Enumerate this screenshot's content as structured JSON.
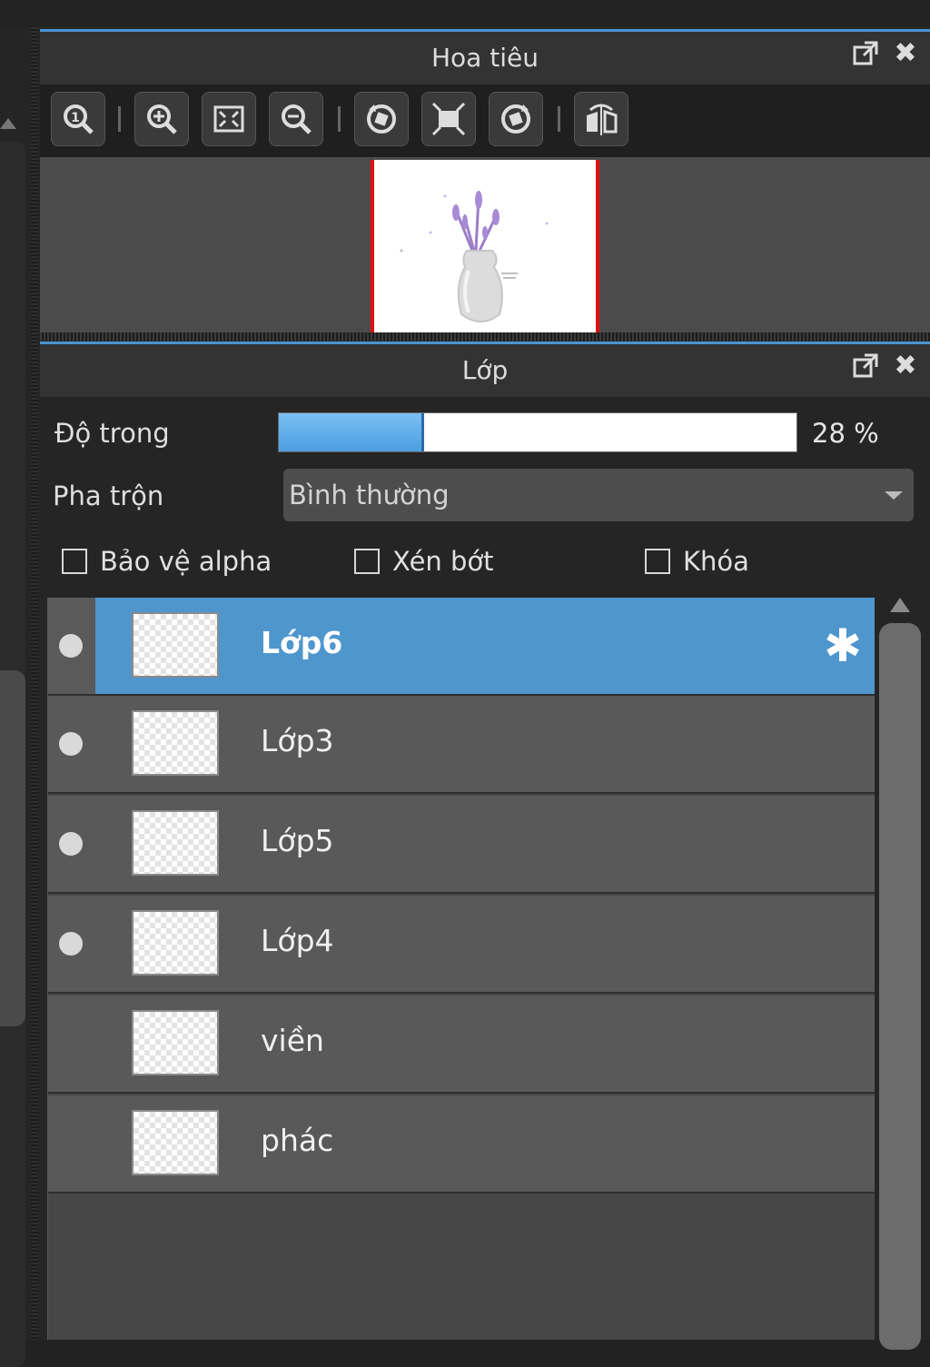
{
  "navigator": {
    "title": "Hoa tiêu",
    "toolbar": [
      {
        "icon": "zoom-actual-size-icon"
      },
      {
        "icon": "zoom-in-icon"
      },
      {
        "icon": "fit-to-window-icon"
      },
      {
        "icon": "zoom-out-icon"
      },
      {
        "icon": "rotate-left-icon"
      },
      {
        "icon": "fit-screen-icon"
      },
      {
        "icon": "rotate-right-icon"
      },
      {
        "icon": "flip-horizontal-icon"
      }
    ],
    "preview_image": "vase-with-lavender-preview"
  },
  "layers": {
    "title": "Lớp",
    "opacity_label": "Độ trong",
    "opacity_percent": 28,
    "opacity_value_text": "28 %",
    "blend_label": "Pha trộn",
    "blend_value": "Bình thường",
    "checkboxes": {
      "protect_alpha": {
        "label": "Bảo vệ alpha",
        "checked": false
      },
      "clip": {
        "label": "Xén bớt",
        "checked": false
      },
      "lock": {
        "label": "Khóa",
        "checked": false
      }
    },
    "items": [
      {
        "name": "Lớp6",
        "visible": true,
        "selected": true
      },
      {
        "name": "Lớp3",
        "visible": true,
        "selected": false
      },
      {
        "name": "Lớp5",
        "visible": true,
        "selected": false
      },
      {
        "name": "Lớp4",
        "visible": true,
        "selected": false
      },
      {
        "name": "viền",
        "visible": false,
        "selected": false
      },
      {
        "name": "phác",
        "visible": false,
        "selected": false
      }
    ]
  },
  "colors": {
    "accent": "#4f96cd",
    "header_border": "#4a93d1",
    "preview_border": "#e01010"
  }
}
